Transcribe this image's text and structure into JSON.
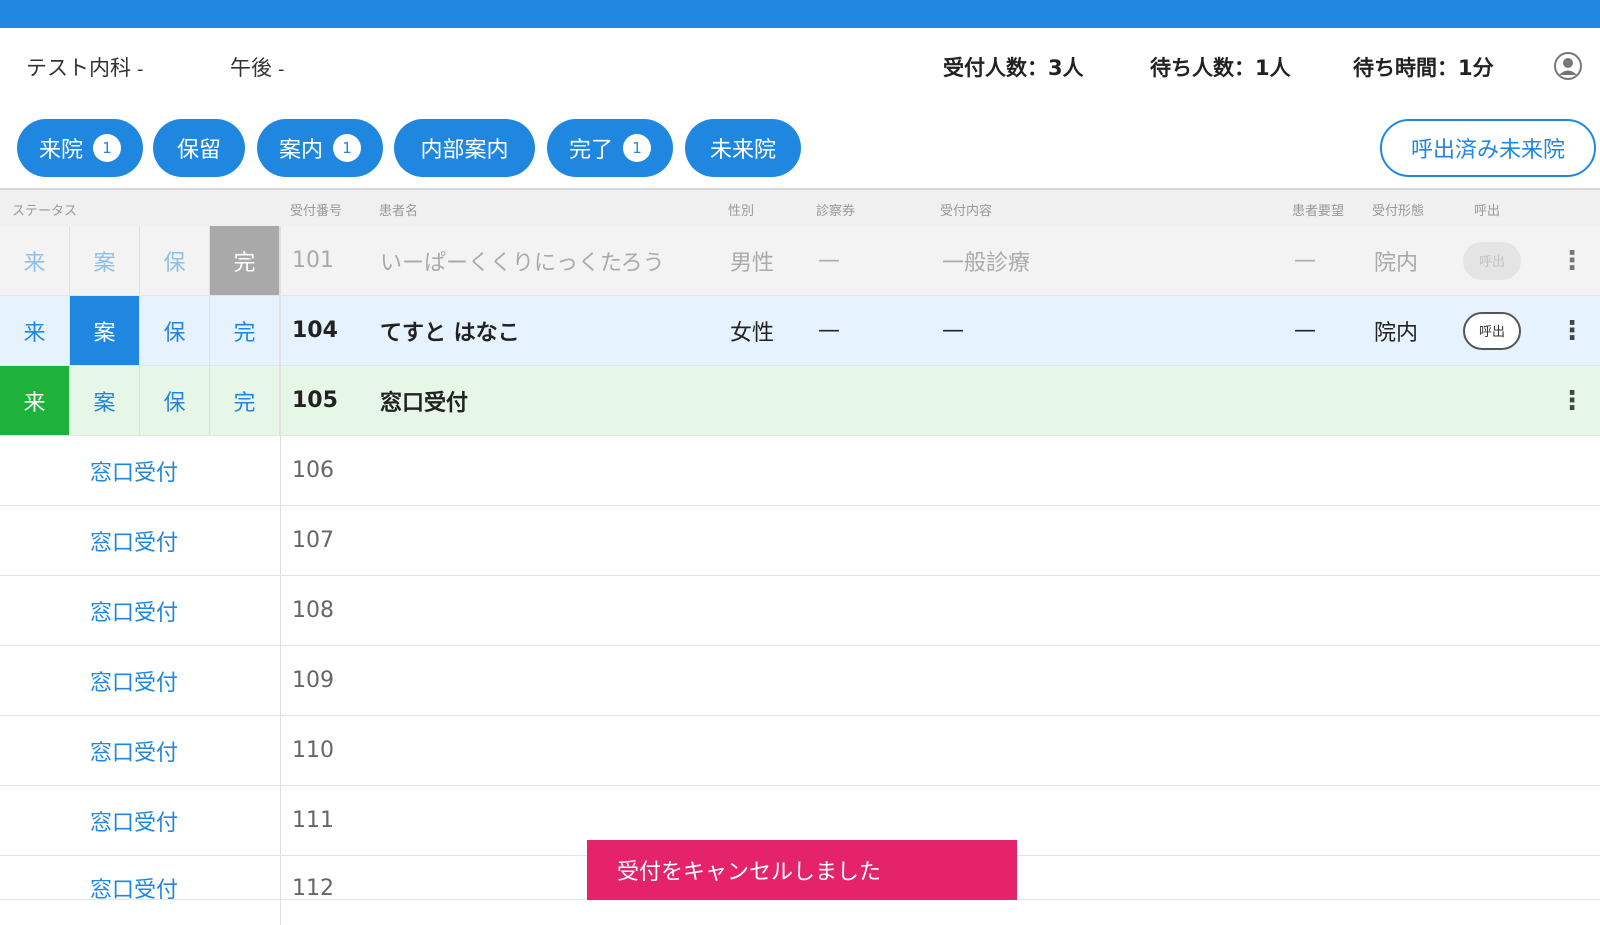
{
  "header": {
    "department": "テスト内科",
    "time_slot": "午後",
    "reception_count": "受付人数：3人",
    "waiting_count": "待ち人数：1人",
    "waiting_time": "待ち時間：1分"
  },
  "filters": {
    "arrival": {
      "label": "来院",
      "count": "1"
    },
    "hold": {
      "label": "保留"
    },
    "guide": {
      "label": "案内",
      "count": "1"
    },
    "internal_guide": {
      "label": "内部案内"
    },
    "done": {
      "label": "完了",
      "count": "1"
    },
    "no_show": {
      "label": "未来院"
    },
    "called_no_show": "呼出済み未来院"
  },
  "columns": {
    "status": "ステータス",
    "reception_number": "受付番号",
    "patient_name": "患者名",
    "gender": "性別",
    "ticket": "診察券",
    "content": "受付内容",
    "request": "患者要望",
    "form": "受付形態",
    "call": "呼出"
  },
  "status_labels": {
    "arrival": "来",
    "guide": "案",
    "hold": "保",
    "done": "完"
  },
  "rows": [
    {
      "number": "101",
      "name": "いーぱーくくりにっくたろう",
      "gender": "男性",
      "ticket": "—",
      "content": "一般診療",
      "request": "—",
      "form": "院内",
      "call": "呼出",
      "active_status": "done"
    },
    {
      "number": "104",
      "name": "てすと はなこ",
      "gender": "女性",
      "ticket": "—",
      "content": "—",
      "request": "—",
      "form": "院内",
      "call": "呼出",
      "active_status": "guide"
    },
    {
      "number": "105",
      "name": "窓口受付",
      "active_status": "arrival"
    }
  ],
  "empty_rows": [
    {
      "number": "106",
      "link": "窓口受付"
    },
    {
      "number": "107",
      "link": "窓口受付"
    },
    {
      "number": "108",
      "link": "窓口受付"
    },
    {
      "number": "109",
      "link": "窓口受付"
    },
    {
      "number": "110",
      "link": "窓口受付"
    },
    {
      "number": "111",
      "link": "窓口受付"
    },
    {
      "number": "112",
      "link": "窓口受付"
    }
  ],
  "toast": "受付をキャンセルしました",
  "colors": {
    "primary": "#1f87e0",
    "arrival_green": "#1db33a",
    "toast_pink": "#e4236b",
    "done_gray": "#a9a9a9"
  },
  "icons": {
    "account": "account-circle-icon",
    "menu": "more-vertical-icon"
  }
}
